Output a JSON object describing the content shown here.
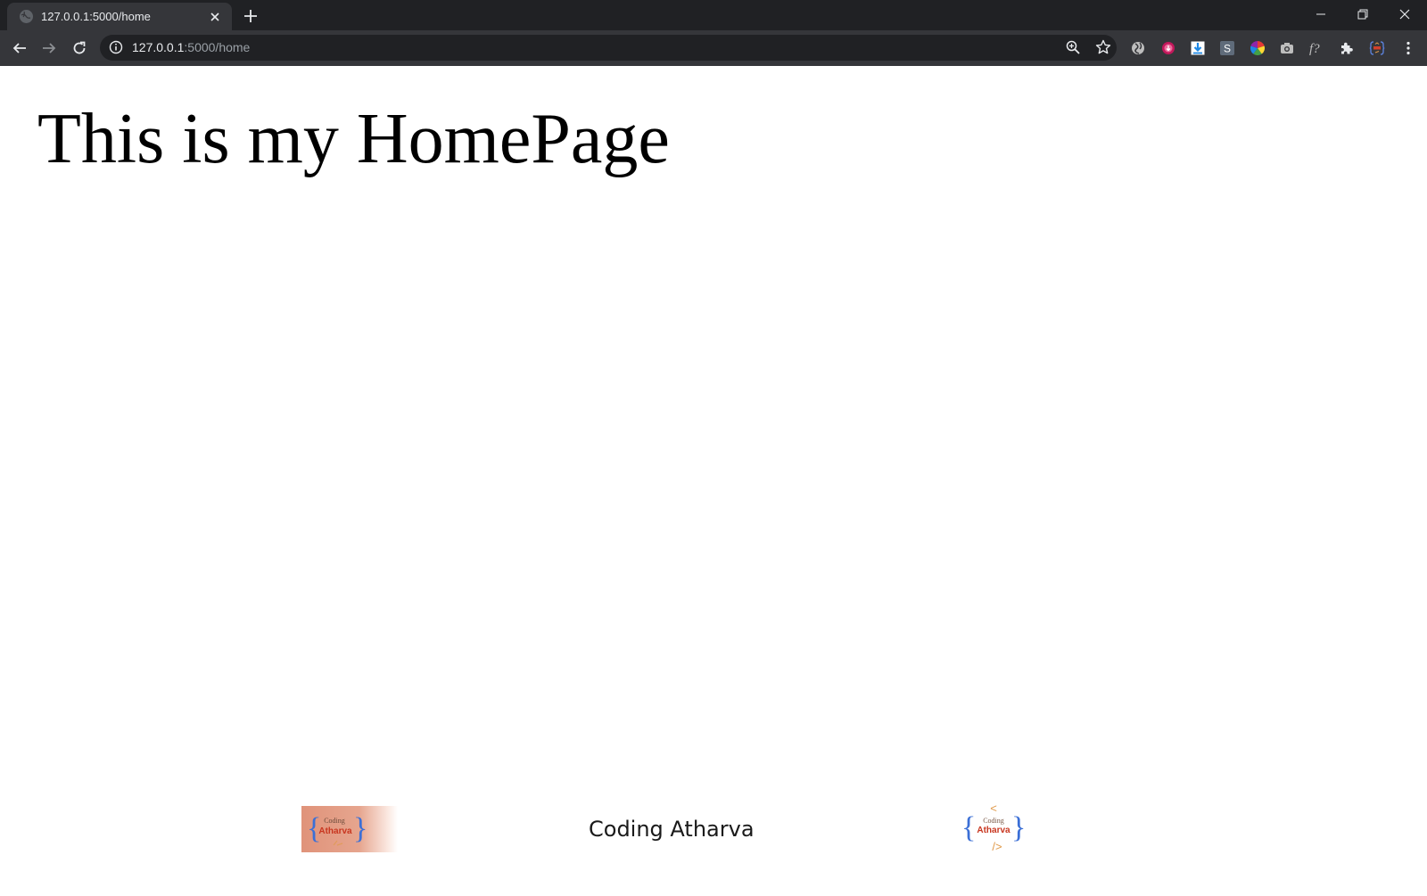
{
  "browser": {
    "tab": {
      "title": "127.0.0.1:5000/home"
    },
    "address_bar": {
      "host": "127.0.0.1",
      "path": ":5000/home"
    },
    "icons": {
      "favicon": "globe-icon",
      "tab_close": "close-icon",
      "new_tab": "plus-icon",
      "back": "arrow-left-icon",
      "forward": "arrow-right-icon",
      "reload": "reload-icon",
      "site_info": "info-icon",
      "zoom": "zoom-icon",
      "bookmark": "star-icon",
      "menu": "kebab-menu-icon"
    },
    "extensions": [
      "swirl-extension-icon",
      "pink-download-extension-icon",
      "blue-download-extension-icon",
      "s-extension-icon",
      "color-wheel-extension-icon",
      "camera-extension-icon",
      "font-extension-icon",
      "puzzle-extensions-icon",
      "profile-extension-icon"
    ],
    "extension_labels": {
      "s": "S",
      "font": "f?"
    }
  },
  "page": {
    "heading": "This is my HomePage",
    "footer": {
      "brand_text": "Coding Atharva",
      "logo_left": {
        "top_word": "Coding",
        "main_word": "Atharva"
      },
      "logo_right": {
        "open_tag": "<",
        "top_word": "Coding",
        "main_word": "Atharva",
        "close_tag": "/>"
      }
    }
  },
  "colors": {
    "chrome_dark": "#202124",
    "chrome_toolbar": "#35363a",
    "logo_red": "#d2402b",
    "logo_blue": "#3b6fd6",
    "logo_orange": "#e09a4a"
  }
}
